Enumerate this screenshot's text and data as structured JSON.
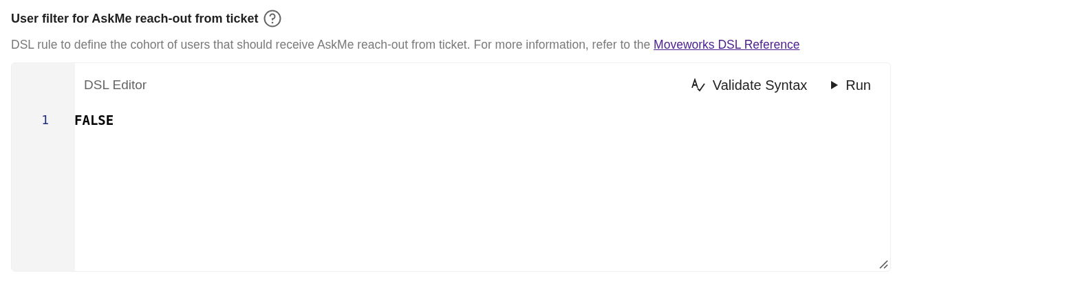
{
  "field": {
    "label": "User filter for AskMe reach-out from ticket",
    "description": "DSL rule to define the cohort of users that should receive AskMe reach-out from ticket. For more information, refer to the",
    "link": "Moveworks DSL Reference"
  },
  "editor": {
    "title": "DSL Editor",
    "actions": [
      {
        "kind": "validate",
        "label": "Validate Syntax"
      },
      {
        "kind": "run",
        "label": "Run"
      }
    ],
    "lines": [
      {
        "number": "1",
        "code": "FALSE"
      }
    ]
  }
}
